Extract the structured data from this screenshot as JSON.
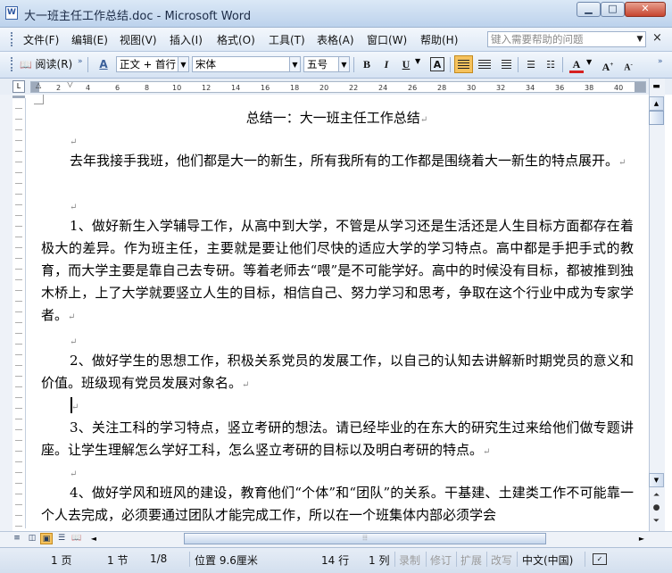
{
  "window": {
    "title": "大一班主任工作总结.doc - Microsoft Word",
    "icon_label": "W",
    "minimize": "▁",
    "maximize": "□",
    "close": "✕"
  },
  "menu": {
    "items": [
      "文件(F)",
      "编辑(E)",
      "视图(V)",
      "插入(I)",
      "格式(O)",
      "工具(T)",
      "表格(A)",
      "窗口(W)",
      "帮助(H)"
    ],
    "help_placeholder": "键入需要帮助的问题",
    "doc_close": "×"
  },
  "toolbar": {
    "read_label": "阅读(R)",
    "style_value": "正文 + 首行",
    "font_value": "宋体",
    "size_value": "五号",
    "bold": "B",
    "italic": "I",
    "underline": "U",
    "char_border": "A",
    "font_color": "A",
    "grow_font": "A",
    "shrink_font": "A",
    "accent": "#f5c25d",
    "font_color_bar": "#d62020"
  },
  "ruler": {
    "ticks": [
      "2",
      "4",
      "6",
      "8",
      "10",
      "12",
      "14",
      "16",
      "18",
      "20",
      "22",
      "24",
      "26",
      "28",
      "30",
      "32",
      "34",
      "36",
      "38",
      "40"
    ],
    "corner": "L"
  },
  "document": {
    "title": "总结一：大一班主任工作总结",
    "paragraphs": [
      "去年我接手我班，他们都是大一的新生，所有我所有的工作都是围绕着大一新生的特点展开。",
      "1、做好新生入学辅导工作，从高中到大学，不管是从学习还是生活还是人生目标方面都存在着极大的差异。作为班主任，主要就是要让他们尽快的适应大学的学习特点。高中都是手把手式的教育，而大学主要是靠自己去专研。等着老师去“喂”是不可能学好。高中的时候没有目标，都被推到独木桥上，上了大学就要竖立人生的目标，相信自己、努力学习和思考，争取在这个行业中成为专家学者。",
      "2、做好学生的思想工作，积极关系党员的发展工作，以自己的认知去讲解新时期党员的意义和价值。班级现有党员发展对象名。",
      "3、关注工科的学习特点，竖立考研的想法。请已经毕业的在东大的研究生过来给他们做专题讲座。让学生理解怎么学好工科，怎么竖立考研的目标以及明白考研的特点。",
      "4、做好学风和班风的建设，教育他们“个体”和“团队”的关系。干基建、土建类工作不可能靠一个人去完成，必须要通过团队才能完成工作，所以在一个班集体内部必须学会"
    ],
    "para_mark": "↵"
  },
  "status": {
    "page": "1 页",
    "section": "1 节",
    "page_of": "1/8",
    "position": "位置 9.6厘米",
    "line": "14 行",
    "column": "1 列",
    "rec": "录制",
    "trk": "修订",
    "ext": "扩展",
    "ovr": "改写",
    "language": "中文(中国)"
  }
}
